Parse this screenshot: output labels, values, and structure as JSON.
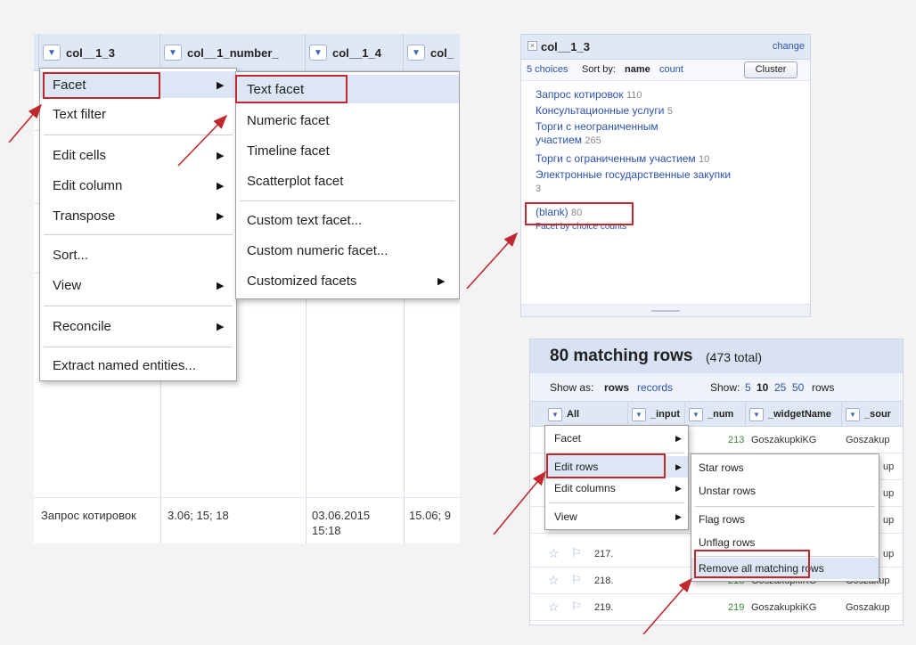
{
  "left": {
    "columns": [
      "col__1_3",
      "col__1_number_",
      "col__1_4",
      "col_"
    ],
    "bottom_row": [
      "Запрос котировок",
      "3.06; 15; 18",
      "03.06.2015 15:18",
      "15.06; 9"
    ],
    "partial_cells": [
      "9"
    ],
    "menu": {
      "facet": "Facet",
      "text_filter": "Text filter",
      "edit_cells": "Edit cells",
      "edit_column": "Edit column",
      "transpose": "Transpose",
      "sort": "Sort...",
      "view": "View",
      "reconcile": "Reconcile",
      "extract": "Extract named entities..."
    },
    "submenu": {
      "text_facet": "Text facet",
      "numeric_facet": "Numeric facet",
      "timeline_facet": "Timeline facet",
      "scatterplot_facet": "Scatterplot facet",
      "custom_text_facet": "Custom text facet...",
      "custom_numeric_facet": "Custom numeric facet...",
      "customized_facets": "Customized facets"
    }
  },
  "facet_panel": {
    "title": "col__1_3",
    "change": "change",
    "choices_count": "5 choices",
    "sort_by": "Sort by:",
    "sort_name": "name",
    "sort_count": "count",
    "cluster": "Cluster",
    "choices": [
      {
        "label": "Запрос котировок",
        "count": "110"
      },
      {
        "label": "Консультационные услуги",
        "count": "5"
      },
      {
        "label": "Торги с неограниченным участием",
        "count": "265"
      },
      {
        "label": "Торги с ограниченным участием",
        "count": "10"
      },
      {
        "label": "Электронные государственные закупки",
        "count": "3"
      },
      {
        "label": "(blank)",
        "count": "80"
      }
    ],
    "facet_by_counts": "Facet by choice counts"
  },
  "rows_panel": {
    "title": "80 matching rows",
    "total": "(473 total)",
    "show_as": "Show as:",
    "rows": "rows",
    "records": "records",
    "show": "Show:",
    "page_sizes": [
      "5",
      "10",
      "25",
      "50"
    ],
    "rows_suffix": "rows",
    "columns": [
      "All",
      "_input",
      "_num",
      "_widgetName",
      "_sour"
    ],
    "data_rows": [
      {
        "idx": "",
        "num": "213",
        "widget": "GoszakupkiKG",
        "source": "Goszakup"
      },
      {
        "idx": "",
        "num": "",
        "widget": "",
        "source": "up"
      },
      {
        "idx": "",
        "num": "",
        "widget": "",
        "source": "up"
      },
      {
        "idx": "",
        "num": "",
        "widget": "",
        "source": "up"
      },
      {
        "idx": "217.",
        "num": "",
        "widget": "",
        "source": "up"
      },
      {
        "idx": "218.",
        "num": "218",
        "widget": "GoszakupkiKG",
        "source": "Goszakup"
      },
      {
        "idx": "219.",
        "num": "219",
        "widget": "GoszakupkiKG",
        "source": "Goszakup"
      }
    ],
    "menu": {
      "facet": "Facet",
      "edit_rows": "Edit rows",
      "edit_columns": "Edit columns",
      "view": "View"
    },
    "submenu": {
      "star_rows": "Star rows",
      "unstar_rows": "Unstar rows",
      "flag_rows": "Flag rows",
      "unflag_rows": "Unflag rows",
      "remove_matching": "Remove all matching rows"
    }
  },
  "colors": {
    "accent": "#c0282d",
    "link": "#2b52b0",
    "header": "#e1e8f5"
  }
}
